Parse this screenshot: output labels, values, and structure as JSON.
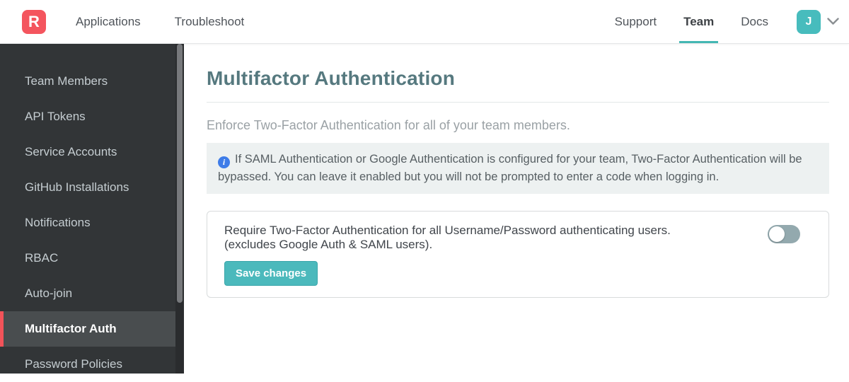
{
  "navbar": {
    "logo_letter": "R",
    "left_items": [
      {
        "label": "Applications"
      },
      {
        "label": "Troubleshoot"
      }
    ],
    "right_items": [
      {
        "label": "Support",
        "active": false
      },
      {
        "label": "Team",
        "active": true
      },
      {
        "label": "Docs",
        "active": false
      }
    ],
    "avatar_initial": "J",
    "icons": {
      "user_menu": "chevron-down-icon"
    }
  },
  "sidebar": {
    "items": [
      {
        "label": "Team Members",
        "active": false
      },
      {
        "label": "API Tokens",
        "active": false
      },
      {
        "label": "Service Accounts",
        "active": false
      },
      {
        "label": "GitHub Installations",
        "active": false
      },
      {
        "label": "Notifications",
        "active": false
      },
      {
        "label": "RBAC",
        "active": false
      },
      {
        "label": "Auto-join",
        "active": false
      },
      {
        "label": "Multifactor Auth",
        "active": true
      },
      {
        "label": "Password Policies",
        "active": false
      }
    ]
  },
  "main": {
    "title": "Multifactor Authentication",
    "subtitle": "Enforce Two-Factor Authentication for all of your team members.",
    "info_note": {
      "icon": "info-icon",
      "icon_glyph": "i",
      "text": "If SAML Authentication or Google Authentication is configured for your team, Two-Factor Authentication will be bypassed. You can leave it enabled but you will not be prompted to enter a code when logging in."
    },
    "setting": {
      "label_line1": "Require Two-Factor Authentication for all Username/Password authenticating users.",
      "label_line2": "(excludes Google Auth & SAML users).",
      "toggle_state": "off",
      "save_label": "Save changes"
    }
  },
  "colors": {
    "accent_teal": "#47b8b9",
    "brand_red": "#f4555e",
    "sidebar_active_red": "#f25359",
    "title_teal": "#56797f",
    "info_icon_blue": "#3e7ce8",
    "toggle_track_off": "#93a9ae"
  }
}
